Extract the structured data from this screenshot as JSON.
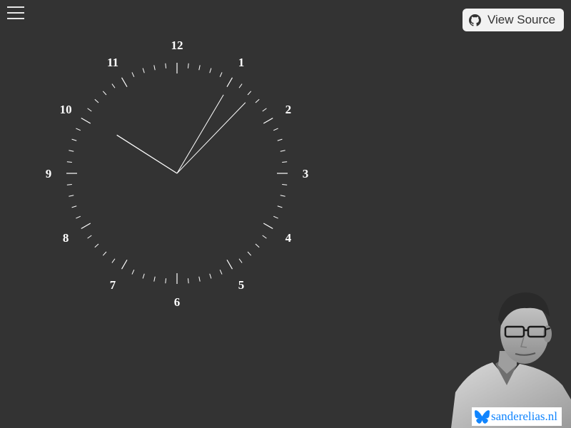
{
  "page": {
    "background_color": "#333333"
  },
  "menu": {
    "icon": "hamburger-menu-icon"
  },
  "view_source": {
    "label": "View Source",
    "icon": "github-icon"
  },
  "clock": {
    "hour_numbers": [
      "12",
      "1",
      "2",
      "3",
      "4",
      "5",
      "6",
      "7",
      "8",
      "9",
      "10",
      "11"
    ],
    "time": {
      "hours": 10,
      "minutes": 5,
      "seconds": 6
    },
    "tick_color": "#ffffff",
    "hand_color": "#ffffff"
  },
  "branding": {
    "text": "sanderelias.nl",
    "icon": "butterfly-icon",
    "color": "#1185fe"
  }
}
